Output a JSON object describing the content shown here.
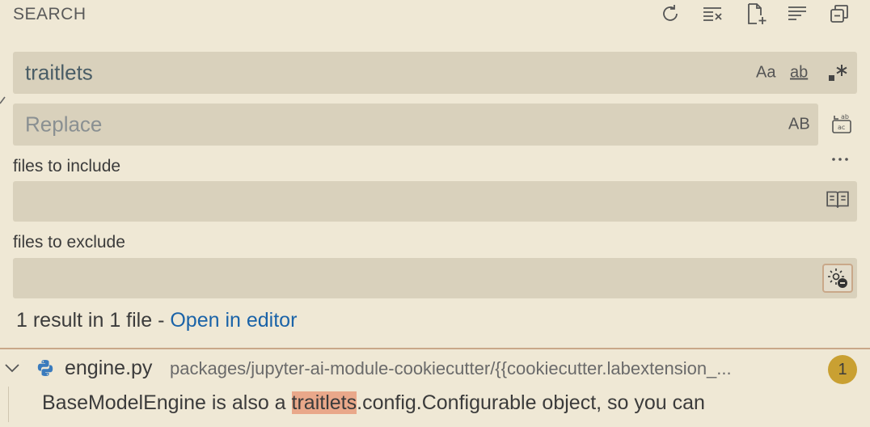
{
  "panel": {
    "title": "SEARCH"
  },
  "header_icons": [
    "refresh-icon",
    "clear-results-icon",
    "new-search-editor-icon",
    "view-as-tree-icon",
    "collapse-all-icon"
  ],
  "search": {
    "value": "traitlets",
    "options": {
      "match_case": "Aa",
      "whole_word": "ab",
      "regex": ".*"
    }
  },
  "replace": {
    "placeholder": "Replace",
    "preserve_case": "AB"
  },
  "include": {
    "label": "files to include",
    "value": ""
  },
  "exclude": {
    "label": "files to exclude",
    "value": ""
  },
  "results": {
    "summary": "1 result in 1 file - ",
    "open_link": "Open in editor",
    "files": [
      {
        "name": "engine.py",
        "path": "packages/jupyter-ai-module-cookiecutter/{{cookiecutter.labextension_...",
        "count": "1",
        "matches": [
          {
            "before": "BaseModelEngine is also a ",
            "match": "traitlets",
            "after": ".config.Configurable object, so you can"
          }
        ]
      }
    ]
  },
  "colors": {
    "background": "#efe8d5",
    "input_bg": "#d9d1bc",
    "link": "#1a63a8",
    "badge": "#c9a032",
    "highlight": "#e9a88a"
  }
}
